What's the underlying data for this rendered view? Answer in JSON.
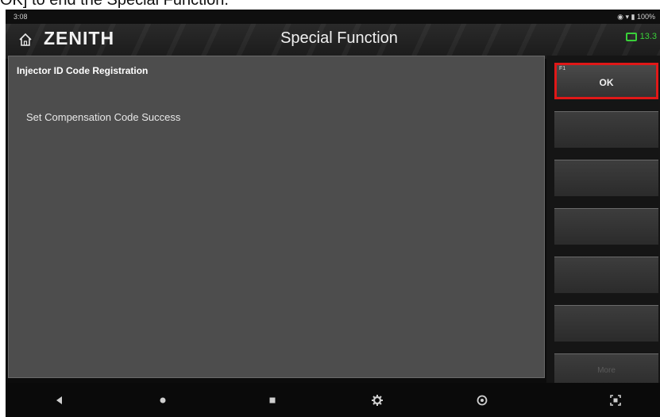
{
  "caption": {
    "text": "OK] to end the Special Function."
  },
  "status_bar": {
    "time": "3:08",
    "right": "100%"
  },
  "app_bar": {
    "brand": "ZENITH",
    "title": "Special Function",
    "battery_text": "13.3",
    "battery_color": "#39d039"
  },
  "panel": {
    "title": "Injector ID Code Registration",
    "message": "Set Compensation Code Success"
  },
  "function_buttons": [
    {
      "key": "F1",
      "label": "OK",
      "active": true
    },
    {
      "key": "",
      "label": "",
      "active": false
    },
    {
      "key": "",
      "label": "",
      "active": false
    },
    {
      "key": "",
      "label": "",
      "active": false
    },
    {
      "key": "",
      "label": "",
      "active": false
    },
    {
      "key": "",
      "label": "",
      "active": false
    },
    {
      "key": "",
      "label": "More",
      "active": false
    }
  ],
  "nav_bar": {
    "items": [
      "back-icon",
      "home-dot-icon",
      "recents-icon",
      "settings-icon",
      "camera-icon",
      "screenshot-icon"
    ]
  },
  "colors": {
    "highlight": "#e01818",
    "panel": "#4d4d4d"
  }
}
